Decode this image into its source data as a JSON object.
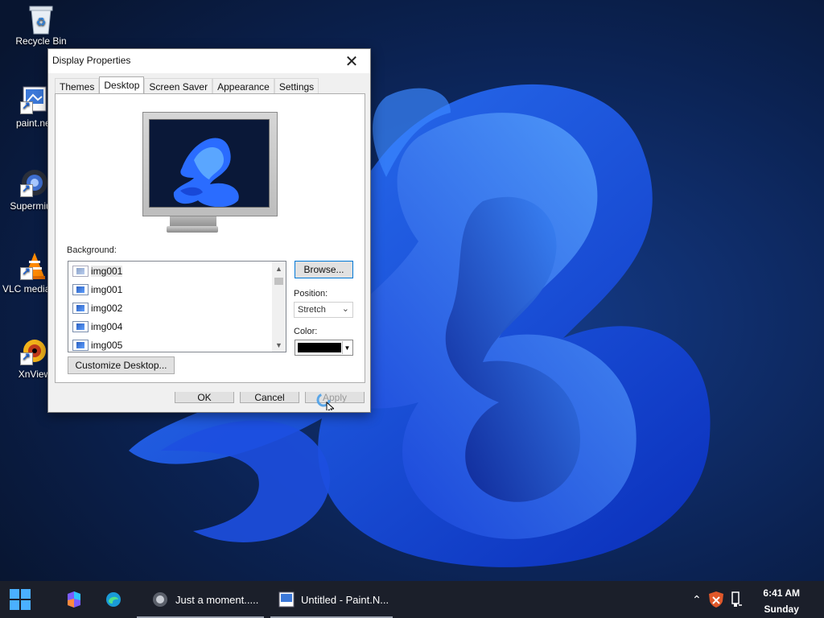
{
  "desktop": {
    "icons": [
      {
        "label": "Recycle Bin",
        "icon": "recycle-bin-icon"
      },
      {
        "label": "paint.net",
        "icon": "paint-net-icon"
      },
      {
        "label": "Supermium",
        "icon": "supermium-icon"
      },
      {
        "label": "VLC media player",
        "icon": "vlc-icon"
      },
      {
        "label": "XnView",
        "icon": "xnview-icon"
      }
    ]
  },
  "dialog": {
    "title": "Display Properties",
    "tabs": [
      "Themes",
      "Desktop",
      "Screen Saver",
      "Appearance",
      "Settings"
    ],
    "active_tab": "Desktop",
    "background_label": "Background:",
    "background_items": [
      "img001",
      "img001",
      "img002",
      "img004",
      "img005"
    ],
    "selected_index": 0,
    "browse_label": "Browse...",
    "position_label": "Position:",
    "position_value": "Stretch",
    "color_label": "Color:",
    "color_value": "#000000",
    "customize_label": "Customize Desktop...",
    "ok_label": "OK",
    "cancel_label": "Cancel",
    "apply_label": "Apply"
  },
  "taskbar": {
    "apps": [
      {
        "title": "Just a moment.....",
        "icon": "browser-icon"
      },
      {
        "title": "Untitled - Paint.N...",
        "icon": "paint-net-icon"
      }
    ],
    "time": "6:41 AM",
    "day": "Sunday"
  }
}
